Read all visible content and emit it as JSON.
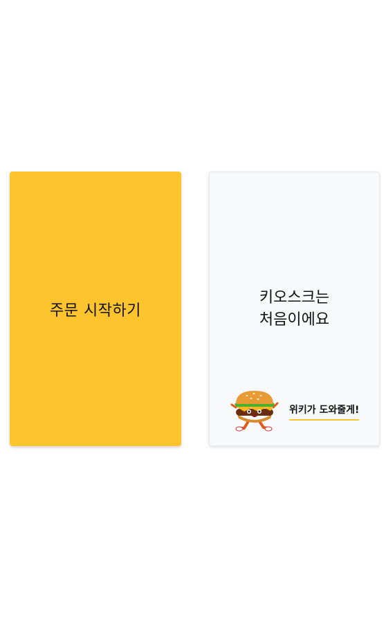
{
  "start_card": {
    "label": "주문 시작하기",
    "color": "#fdc42e"
  },
  "help_card": {
    "title_line1": "키오스크는",
    "title_line2": "처음이에요",
    "helper_text": "위키가 도와줄게!",
    "mascot_icon": "burger-mascot-icon",
    "underline_color": "#fdc42e"
  }
}
